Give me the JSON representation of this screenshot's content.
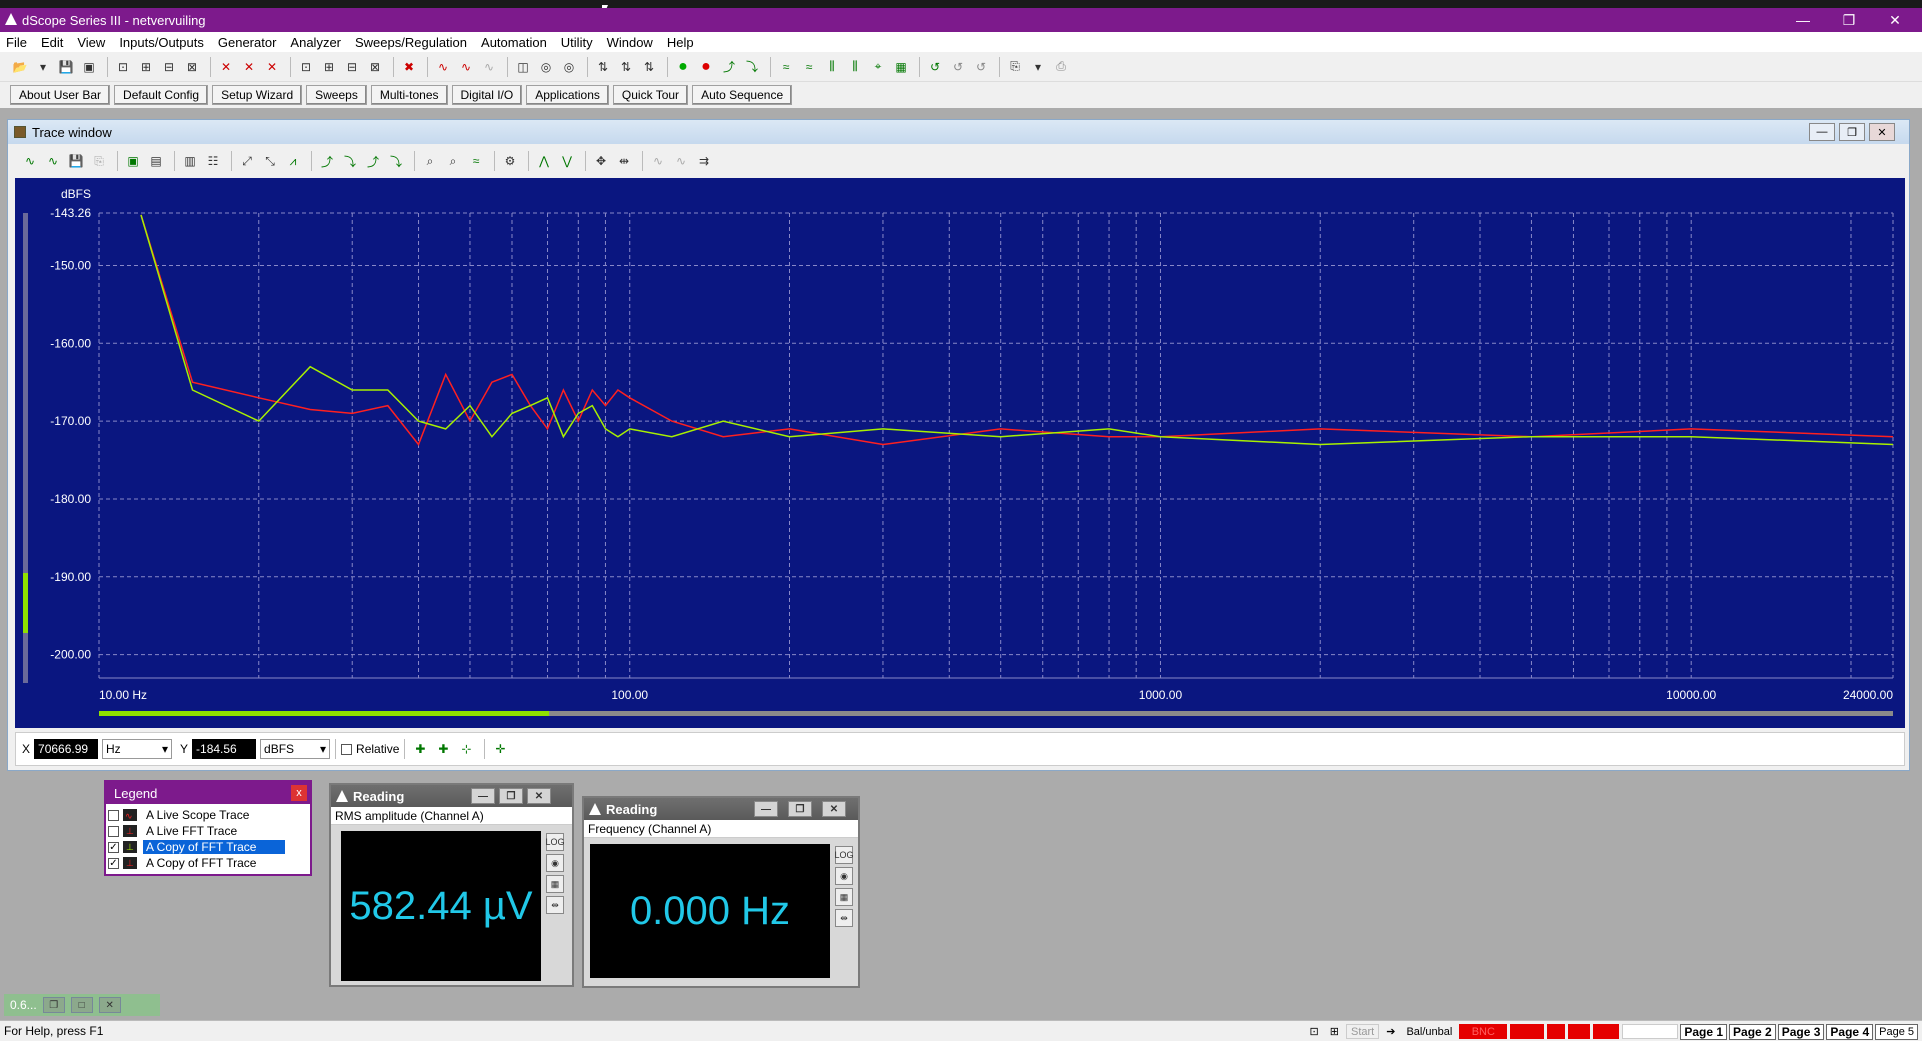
{
  "app": {
    "title": "dScope Series III - netvervuiling",
    "window_controls": [
      "—",
      "❐",
      "✕"
    ]
  },
  "menu": [
    "File",
    "Edit",
    "View",
    "Inputs/Outputs",
    "Generator",
    "Analyzer",
    "Sweeps/Regulation",
    "Automation",
    "Utility",
    "Window",
    "Help"
  ],
  "userbar": [
    "About User Bar",
    "Default Config",
    "Setup Wizard",
    "Sweeps",
    "Multi-tones",
    "Digital I/O",
    "Applications",
    "Quick Tour",
    "Auto Sequence"
  ],
  "trace_window": {
    "title": "Trace window",
    "cursor_readout": {
      "x_label": "X",
      "x_value": "70666.99",
      "x_unit": "Hz",
      "y_label": "Y",
      "y_value": "-184.56",
      "y_unit": "dBFS",
      "relative_label": "Relative"
    }
  },
  "chart_data": {
    "type": "line",
    "ylabel": "dBFS",
    "x_scale": "log",
    "xlim": [
      10,
      24000
    ],
    "ylim": [
      -203,
      -143.26
    ],
    "x_ticks": [
      {
        "value": 10,
        "label": "10.00 Hz"
      },
      {
        "value": 100,
        "label": "100.00"
      },
      {
        "value": 1000,
        "label": "1000.00"
      },
      {
        "value": 10000,
        "label": "10000.00"
      },
      {
        "value": 24000,
        "label": "24000.00"
      }
    ],
    "y_ticks": [
      {
        "value": -143.26,
        "label": "-143.26"
      },
      {
        "value": -150,
        "label": "-150.00"
      },
      {
        "value": -160,
        "label": "-160.00"
      },
      {
        "value": -170,
        "label": "-170.00"
      },
      {
        "value": -180,
        "label": "-180.00"
      },
      {
        "value": -190,
        "label": "-190.00"
      },
      {
        "value": -200,
        "label": "-200.00"
      }
    ],
    "grid": true,
    "background": "#0a1680",
    "series": [
      {
        "color": "#ff2020",
        "x": [
          12,
          15,
          20,
          25,
          30,
          35,
          40,
          45,
          50,
          55,
          60,
          65,
          70,
          75,
          80,
          85,
          90,
          95,
          100,
          120,
          150,
          200,
          300,
          500,
          800,
          1000,
          2000,
          5000,
          10000,
          24000
        ],
        "values": [
          -143.5,
          -165,
          -167,
          -168.5,
          -169,
          -168,
          -173,
          -164,
          -170,
          -165,
          -164,
          -168,
          -171,
          -166,
          -170,
          -166,
          -168,
          -166,
          -167,
          -170,
          -172,
          -171,
          -173,
          -171,
          -172,
          -172,
          -171,
          -172,
          -171,
          -172
        ]
      },
      {
        "color": "#a8f000",
        "x": [
          12,
          15,
          20,
          25,
          30,
          35,
          40,
          45,
          50,
          55,
          60,
          65,
          70,
          75,
          80,
          85,
          90,
          95,
          100,
          120,
          150,
          200,
          300,
          500,
          800,
          1000,
          2000,
          5000,
          10000,
          24000
        ],
        "values": [
          -143.5,
          -166,
          -170,
          -163,
          -166,
          -166,
          -170,
          -171,
          -168,
          -172,
          -169,
          -168,
          -167,
          -172,
          -169,
          -168,
          -171,
          -172,
          -171,
          -172,
          -170,
          -172,
          -171,
          -172,
          -171,
          -172,
          -173,
          -172,
          -172,
          -173
        ]
      }
    ]
  },
  "legend": {
    "title": "Legend",
    "items": [
      {
        "checked": false,
        "label": "A  Live Scope Trace",
        "color": "#ff2020"
      },
      {
        "checked": false,
        "label": "A  Live FFT Trace",
        "color": "#ff2020"
      },
      {
        "checked": true,
        "label": "A  Copy of FFT Trace",
        "color": "#a8f000"
      },
      {
        "checked": true,
        "label": "A  Copy of FFT Trace",
        "color": "#ff2020"
      }
    ]
  },
  "readings": [
    {
      "title": "Reading",
      "label": "RMS amplitude (Channel A)",
      "value": "582.44 µV"
    },
    {
      "title": "Reading",
      "label": "Frequency (Channel A)",
      "value": "0.000 Hz"
    }
  ],
  "minimized_window": {
    "label": "0.6..."
  },
  "status": {
    "help": "For Help, press F1",
    "input": "Bal/unbal",
    "bnc": "BNC",
    "start": "Start",
    "pages": [
      "Page 1",
      "Page 2",
      "Page 3",
      "Page 4",
      "Page 5"
    ]
  }
}
